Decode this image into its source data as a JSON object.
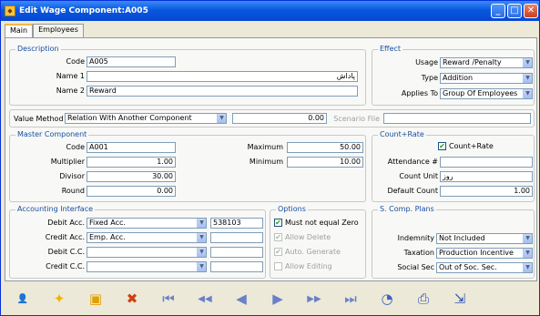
{
  "window": {
    "title": "Edit Wage Component:A005"
  },
  "tabs": [
    {
      "label": "Main"
    },
    {
      "label": "Employees"
    }
  ],
  "description": {
    "group_label": "Description",
    "code_label": "Code",
    "code_value": "A005",
    "name1_label": "Name 1",
    "name1_value": "پاداش",
    "name2_label": "Name 2",
    "name2_value": "Reward"
  },
  "effect": {
    "group_label": "Effect",
    "usage_label": "Usage",
    "usage_value": "Reward /Penalty",
    "type_label": "Type",
    "type_value": "Addition",
    "applies_label": "Applies To",
    "applies_value": "Group Of Employees"
  },
  "value_method": {
    "label": "Value Method",
    "value": "Relation With Another Component",
    "amount": "0.00",
    "scenario_label": "Scenario File",
    "scenario_value": ""
  },
  "master": {
    "group_label": "Master Component",
    "code_label": "Code",
    "code_value": "A001",
    "multiplier_label": "Multiplier",
    "multiplier_value": "1.00",
    "divisor_label": "Divisor",
    "divisor_value": "30.00",
    "round_label": "Round",
    "round_value": "0.00",
    "maximum_label": "Maximum",
    "maximum_value": "50.00",
    "minimum_label": "Minimum",
    "minimum_value": "10.00"
  },
  "count_rate": {
    "group_label": "Count+Rate",
    "checkbox_label": "Count+Rate",
    "checked": true,
    "attendance_label": "Attendance #",
    "attendance_value": "",
    "unit_label": "Count Unit",
    "unit_value": "روز",
    "default_label": "Default Count",
    "default_value": "1.00"
  },
  "accounting": {
    "group_label": "Accounting Interface",
    "debit_label": "Debit Acc.",
    "debit_value": "Fixed Acc.",
    "debit_code": "538103",
    "credit_label": "Credit Acc.",
    "credit_value": "Emp. Acc.",
    "credit_code": "",
    "debit_cc_label": "Debit C.C.",
    "credit_cc_label": "Credit C.C."
  },
  "options": {
    "group_label": "Options",
    "items": [
      {
        "label": "Must not equal Zero",
        "checked": true,
        "enabled": true
      },
      {
        "label": "Allow Delete",
        "checked": true,
        "enabled": false
      },
      {
        "label": "Auto. Generate",
        "checked": true,
        "enabled": false
      },
      {
        "label": "Allow Editing",
        "checked": false,
        "enabled": false
      }
    ]
  },
  "social": {
    "group_label": "S. Comp. Plans",
    "indemnity_label": "Indemnity",
    "indemnity_value": "Not Included",
    "taxation_label": "Taxation",
    "taxation_value": "Production Incentive",
    "socialsec_label": "Social Sec",
    "socialsec_value": "Out of Soc. Sec."
  },
  "toolbar": {
    "buttons": [
      {
        "name": "user-icon",
        "glyph": "👤",
        "color": "#c0392b"
      },
      {
        "name": "new-icon",
        "glyph": "✦",
        "color": "#f0b400"
      },
      {
        "name": "copy-icon",
        "glyph": "▣",
        "color": "#e0a000"
      },
      {
        "name": "delete-icon",
        "glyph": "✖",
        "color": "#d04010"
      },
      {
        "name": "first-icon",
        "glyph": "⏮",
        "color": "#6a80c8"
      },
      {
        "name": "prev-page-icon",
        "glyph": "◀◀",
        "color": "#6a80c8"
      },
      {
        "name": "prev-icon",
        "glyph": "◀",
        "color": "#6a80c8"
      },
      {
        "name": "next-icon",
        "glyph": "▶",
        "color": "#6a80c8"
      },
      {
        "name": "next-page-icon",
        "glyph": "▶▶",
        "color": "#6a80c8"
      },
      {
        "name": "last-icon",
        "glyph": "⏭",
        "color": "#6a80c8"
      },
      {
        "name": "search-icon",
        "glyph": "◔",
        "color": "#4060c0"
      },
      {
        "name": "print-icon",
        "glyph": "⎙",
        "color": "#3050b0"
      },
      {
        "name": "exit-icon",
        "glyph": "⇲",
        "color": "#3050b0"
      }
    ]
  }
}
